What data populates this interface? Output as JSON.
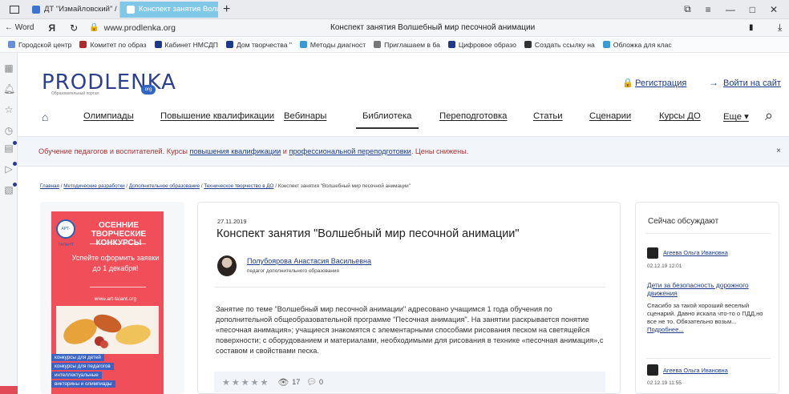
{
  "browser": {
    "tabs": [
      {
        "label": "ДТ \"Измайловский\" / Раб",
        "active": false
      },
      {
        "label": "Конспект занятия Волш",
        "active": true
      }
    ],
    "nav_back_label": "← Word",
    "browser_brand": "Я",
    "url": "www.prodlenka.org",
    "page_title": "Конспект занятия Волшебный мир песочной анимации",
    "bookmarks": [
      "Городской центр",
      "Комитет по образ",
      "Кабинет НМСДП",
      "Дом творчества \"",
      "Методы диагност",
      "Приглашаем в ба",
      "Цифровое образо",
      "Создать ссылку на",
      "Обложка для клас"
    ]
  },
  "site": {
    "logo": "PRODLENKA",
    "logo_badge": "org",
    "logo_sub": "Образовательный портал",
    "register": "Регистрация",
    "login": "Войти на сайт",
    "nav": [
      {
        "label": "Олимпиады",
        "active": false
      },
      {
        "label": "Повышение квалификации",
        "active": false
      },
      {
        "label": "Вебинары",
        "active": false
      },
      {
        "label": "Библиотека",
        "active": true
      },
      {
        "label": "Переподготовка",
        "active": false
      },
      {
        "label": "Статьи",
        "active": false
      },
      {
        "label": "Сценарии",
        "active": false
      },
      {
        "label": "Курсы ДО",
        "active": false
      },
      {
        "label": "Еще ▾",
        "active": false
      }
    ]
  },
  "banner": {
    "text1": "Обучение педагогов и воспитателей. Курсы ",
    "link1": "повышения квалификации",
    "text2": " и ",
    "link2": "профессиональной переподготовки",
    "text3": ". Цены снижены.",
    "close": "×"
  },
  "breadcrumb": {
    "items": [
      "Главная",
      "Методические разработки",
      "Дополнительное образование",
      "Техническое творчество в ДО"
    ],
    "current": "Конспект занятия \"Волшебный мир песочной анимации\""
  },
  "ad": {
    "logo_text": "АРТ-ТАЛАНТ",
    "headline": "ОСЕННИЕ ТВОРЧЕСКИЕ КОНКУРСЫ",
    "cta": "Успейте оформить заявки до 1 декабря!",
    "site": "www.art-talant.org",
    "tags": [
      "конкурсы для детей",
      "конкурсы для педагогов",
      "интеллектуальные",
      "викторины и олимпиады"
    ]
  },
  "article": {
    "date": "27.11.2019",
    "title": "Конспект занятия \"Волшебный мир песочной анимации\"",
    "author": "Полубоярова Анастасия Васильевна",
    "role": "педагог дополнительного образования",
    "body": "Занятие по теме \"Волшебный мир песочной анимации\" адресовано учащимся 1 года обучения по дополнительной общеобразовательной программе \"Песочная анимация\". На занятии раскрывается понятие «песочная анимация»; учащиеся знакомятся с элементарными способами рисования песком на светящейся поверхности; с оборудованием и материалами, необходимыми для рисования в технике «песочная анимация»,с составом и свойствами песка.",
    "rating": 0,
    "views": "17",
    "comments": "0"
  },
  "discussion": {
    "heading": "Сейчас обсуждают",
    "items": [
      {
        "name": "Агеева Ольга Ивановна",
        "time": "02.12.19 12:01",
        "title": "Дети за безопасность дорожного движения",
        "text": "Спасибо за такой хороший веселый сценарий. Давно искала что-то о ПДД,но все не то. Обязательно возьм...",
        "more": "Подробнее..."
      },
      {
        "name": "Агеева Ольга Ивановна",
        "time": "02.12.19 11:55"
      }
    ]
  },
  "colors": {
    "brand": "#2f3f8f",
    "link": "#1f3a8a",
    "ad_bg": "#f04e58",
    "active_tab": "#7fc8e8"
  }
}
